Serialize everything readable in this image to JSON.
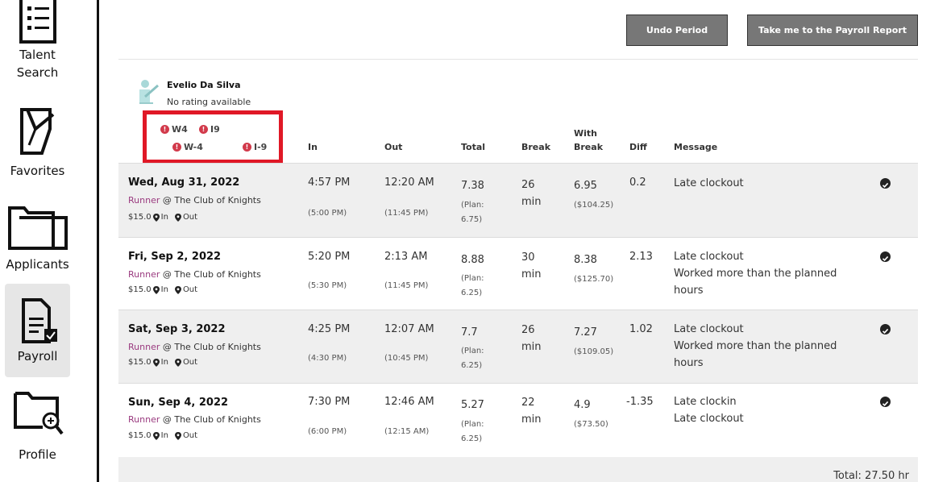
{
  "sidebar": {
    "items": [
      {
        "label_line1": "Talent",
        "label_line2": "Search",
        "icon": "list-document-icon"
      },
      {
        "label": "Favorites",
        "icon": "bookmark-document-icon"
      },
      {
        "label": "Applicants",
        "icon": "folder-icon"
      },
      {
        "label": "Payroll",
        "icon": "payroll-document-check-icon",
        "active": true
      },
      {
        "label": "Profile",
        "icon": "folder-search-icon"
      }
    ]
  },
  "toolbar": {
    "undo_label": "Undo Period",
    "report_label": "Take me to the Payroll Report"
  },
  "employee": {
    "name": "Evelio Da Silva",
    "rating": "No rating available",
    "docs": [
      "W4",
      "I9",
      "W-4",
      "I-9"
    ]
  },
  "table": {
    "headers": {
      "in": "In",
      "out": "Out",
      "total": "Total",
      "break": "Break",
      "with_break_1": "With",
      "with_break_2": "Break",
      "diff": "Diff",
      "message": "Message"
    },
    "rows": [
      {
        "date": "Wed, Aug 31, 2022",
        "role": "Runner",
        "at": "@ The Club of Knights",
        "rate": "$15.0",
        "in_label": "In",
        "out_label": "Out",
        "in": "4:57 PM",
        "in_plan": "(5:00 PM)",
        "out": "12:20 AM",
        "out_plan": "(11:45 PM)",
        "total": "7.38",
        "plan_1": "(Plan:",
        "plan_2": "6.75)",
        "break_1": "26",
        "break_2": "min",
        "with_break": "6.95",
        "with_break_pay": "($104.25)",
        "diff": "0.2",
        "messages": [
          "Late clockout"
        ]
      },
      {
        "date": "Fri, Sep 2, 2022",
        "role": "Runner",
        "at": "@ The Club of Knights",
        "rate": "$15.0",
        "in_label": "In",
        "out_label": "Out",
        "in": "5:20 PM",
        "in_plan": "(5:30 PM)",
        "out": "2:13 AM",
        "out_plan": "(11:45 PM)",
        "total": "8.88",
        "plan_1": "(Plan:",
        "plan_2": "6.25)",
        "break_1": "30",
        "break_2": "min",
        "with_break": "8.38",
        "with_break_pay": "($125.70)",
        "diff": "2.13",
        "messages": [
          "Late clockout",
          "Worked more than the planned",
          "hours"
        ]
      },
      {
        "date": "Sat, Sep 3, 2022",
        "role": "Runner",
        "at": "@ The Club of Knights",
        "rate": "$15.0",
        "in_label": "In",
        "out_label": "Out",
        "in": "4:25 PM",
        "in_plan": "(4:30 PM)",
        "out": "12:07 AM",
        "out_plan": "(10:45 PM)",
        "total": "7.7",
        "plan_1": "(Plan:",
        "plan_2": "6.25)",
        "break_1": "26",
        "break_2": "min",
        "with_break": "7.27",
        "with_break_pay": "($109.05)",
        "diff": "1.02",
        "messages": [
          "Late clockout",
          "Worked more than the planned",
          "hours"
        ]
      },
      {
        "date": "Sun, Sep 4, 2022",
        "role": "Runner",
        "at": "@ The Club of Knights",
        "rate": "$15.0",
        "in_label": "In",
        "out_label": "Out",
        "in": "7:30 PM",
        "in_plan": "(6:00 PM)",
        "out": "12:46 AM",
        "out_plan": "(12:15 AM)",
        "total": "5.27",
        "plan_1": "(Plan:",
        "plan_2": "6.25)",
        "break_1": "22",
        "break_2": "min",
        "with_break": "4.9",
        "with_break_pay": "($73.50)",
        "diff": "-1.35",
        "messages": [
          "Late clockin",
          "Late clockout"
        ]
      }
    ]
  },
  "footer": {
    "total": "Total: 27.50 hr"
  },
  "colors": {
    "button_bg": "#777777",
    "highlight_box": "#e01826",
    "role": "#9a3a7f",
    "alert": "#d23a4b"
  }
}
